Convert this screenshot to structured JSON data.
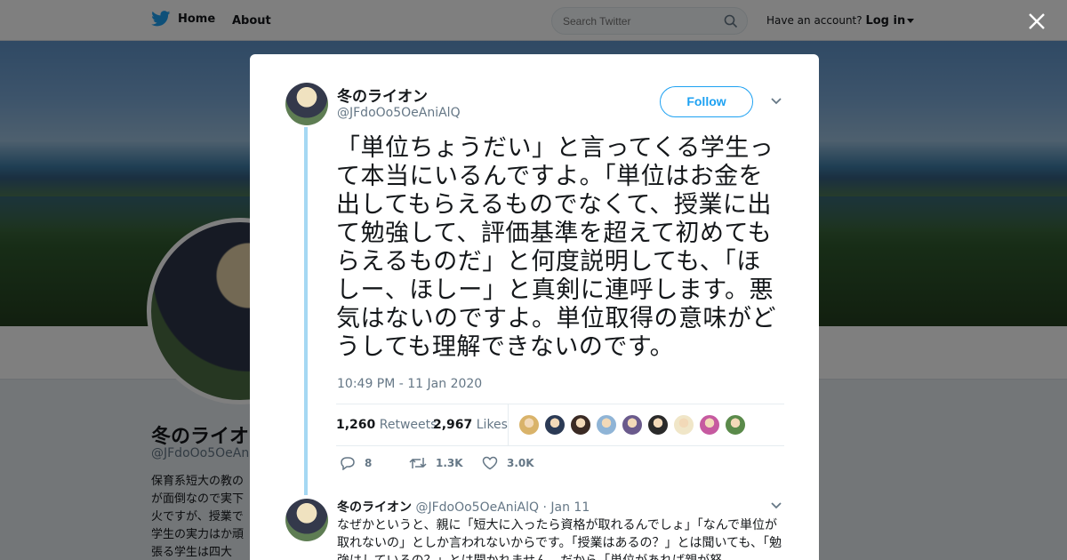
{
  "topbar": {
    "home_label": "Home",
    "about_label": "About",
    "search_placeholder": "Search Twitter",
    "have_account": "Have an account?",
    "login_label": "Log in"
  },
  "profile": {
    "name": "冬のライオン",
    "handle": "@JFdoOo5OeAniAlQ",
    "bio": "保育系短大の教のが面倒なので実下火ですが、授業で学生の実力はか頑張る学生は四大"
  },
  "tweet": {
    "name": "冬のライオン",
    "handle": "@JFdoOo5OeAniAlQ",
    "follow_label": "Follow",
    "text": "「単位ちょうだい」と言ってくる学生って本当にいるんですよ。「単位はお金を出してもらえるものでなくて、授業に出て勉強して、評価基準を超えて初めてもらえるものだ」と何度説明しても、「ほしー、ほしー」と真剣に連呼します。悪気はないのですよ。単位取得の意味がどうしても理解できないのです。",
    "timestamp": "10:49 PM - 11 Jan 2020",
    "retweets_count": "1,260",
    "retweets_label": "Retweets",
    "likes_count": "2,967",
    "likes_label": "Likes",
    "replies_short": "8",
    "retweets_short": "1.3K",
    "likes_short": "3.0K",
    "liker_avatar_colors": [
      "#d9b36a",
      "#2b3a55",
      "#3a2a24",
      "#8fb4d6",
      "#6a5a8c",
      "#2a2a2a",
      "#f0e6c8",
      "#c65aa0",
      "#5a8a4a"
    ]
  },
  "reply": {
    "name": "冬のライオン",
    "handle": "@JFdoOo5OeAniAlQ",
    "date": "· Jan 11",
    "text": "なぜかというと、親に「短大に入ったら資格が取れるんでしょ」「なんで単位が取れないの」としか言われないからです。「授業はあるの？」とは聞いても、「勉強はしているの？」とは聞かれません。だから「単位があれば親が怒"
  },
  "colors": {
    "brand": "#1da1f2",
    "thread_line": "#a5d8f3",
    "muted_text": "#657786"
  }
}
